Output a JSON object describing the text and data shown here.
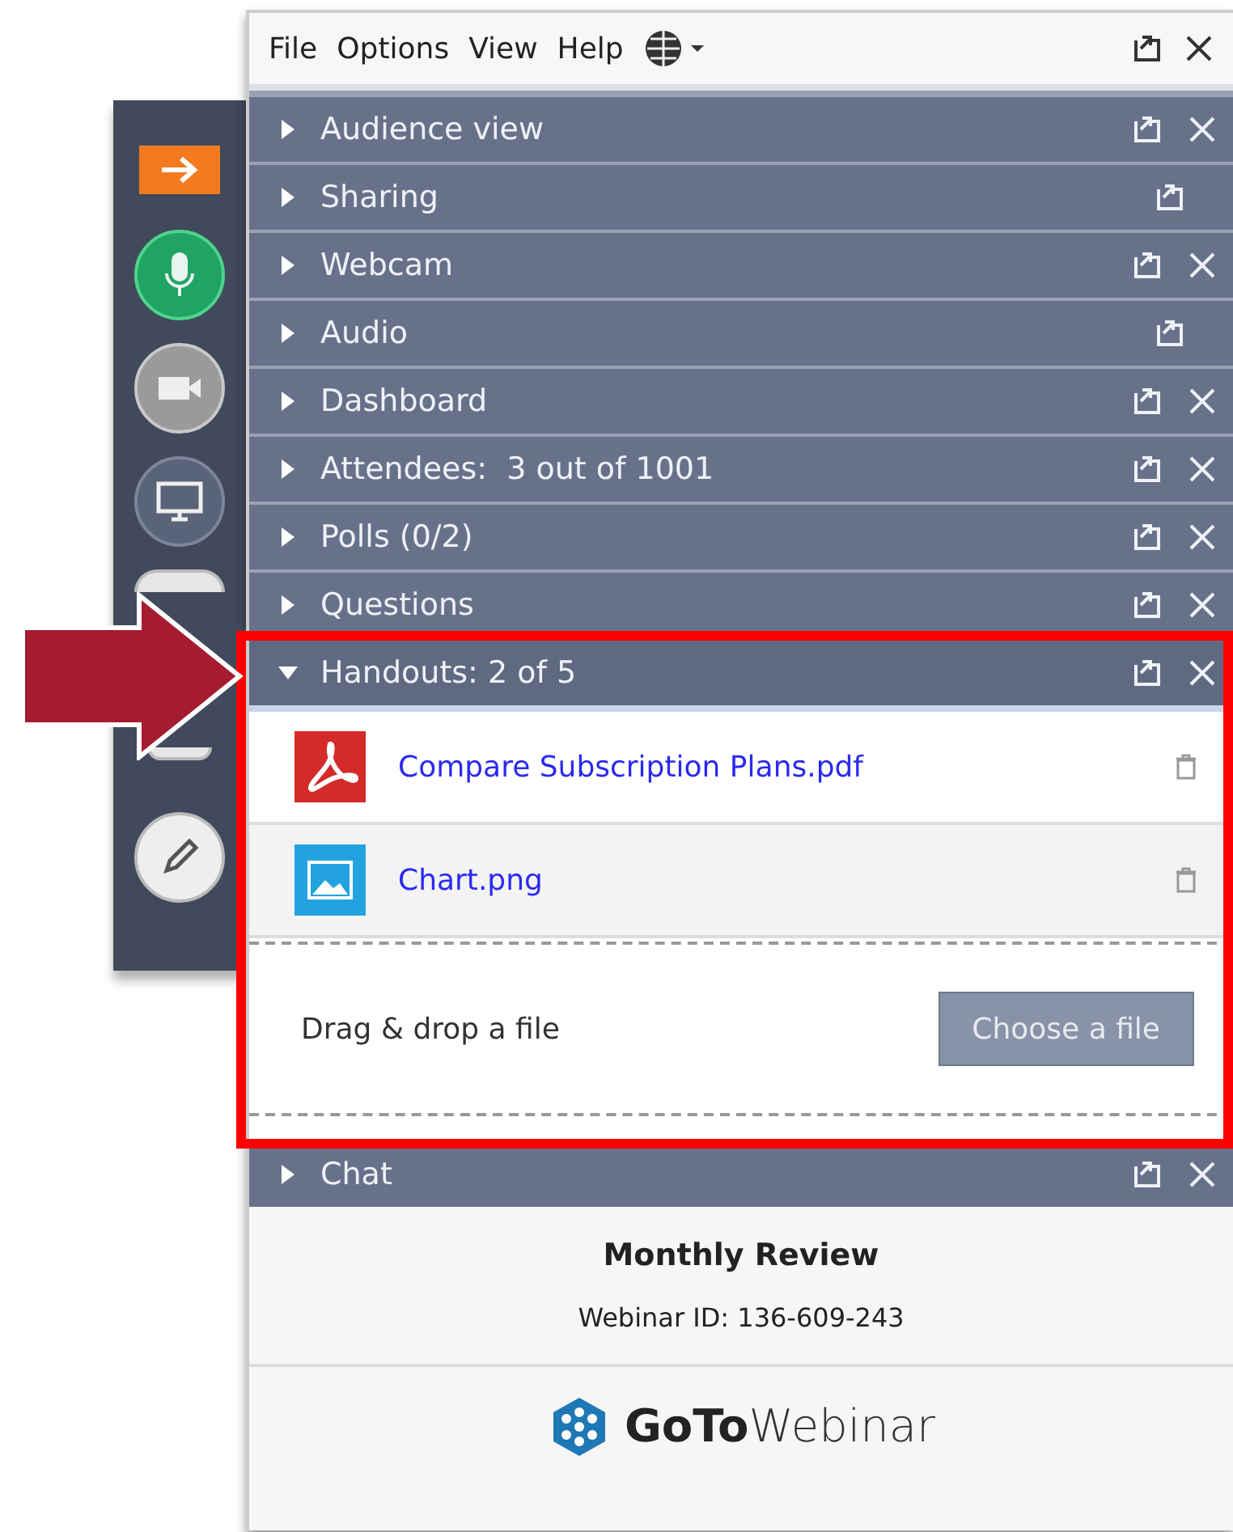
{
  "menu": [
    "File",
    "Options",
    "View",
    "Help"
  ],
  "panels": [
    {
      "title": "Audience view",
      "expanded": false,
      "closable": true
    },
    {
      "title": "Sharing",
      "expanded": false,
      "closable": false
    },
    {
      "title": "Webcam",
      "expanded": false,
      "closable": true
    },
    {
      "title": "Audio",
      "expanded": false,
      "closable": false
    },
    {
      "title": "Dashboard",
      "expanded": false,
      "closable": true
    },
    {
      "title": "Attendees:  3 out of 1001",
      "expanded": false,
      "closable": true
    },
    {
      "title": "Polls (0/2)",
      "expanded": false,
      "closable": true
    },
    {
      "title": "Questions",
      "expanded": false,
      "closable": true
    },
    {
      "title": "Handouts: 2 of 5",
      "expanded": true,
      "closable": true,
      "files": [
        {
          "kind": "pdf",
          "name": "Compare Subscription Plans.pdf"
        },
        {
          "kind": "image",
          "name": "Chart.png"
        }
      ],
      "drop_label": "Drag & drop a file",
      "choose_button": "Choose a file"
    },
    {
      "title": "Chat",
      "expanded": false,
      "closable": true
    }
  ],
  "toolbar": [
    {
      "kind": "arrow"
    },
    {
      "kind": "mic"
    },
    {
      "kind": "camera"
    },
    {
      "kind": "screen"
    },
    {
      "kind": "partial_top"
    },
    {
      "kind": "partial_bottom"
    },
    {
      "kind": "pencil"
    }
  ],
  "footer": {
    "title": "Monthly Review",
    "webinar_id": "Webinar ID: 136-609-243",
    "logo_bold": "GoTo",
    "logo_light": "Webinar"
  }
}
